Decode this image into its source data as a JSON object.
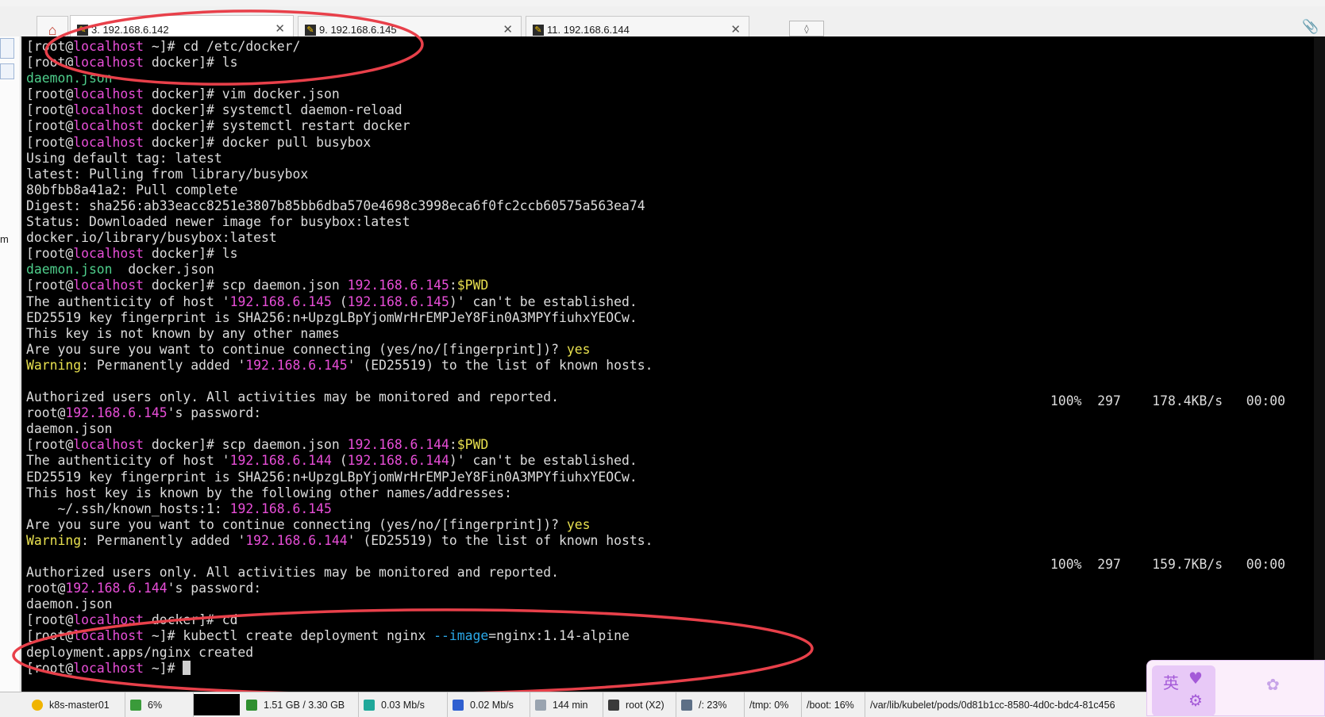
{
  "tabs": [
    {
      "label": "3. 192.168.6.142",
      "active": true
    },
    {
      "label": "9. 192.168.6.145",
      "active": false
    },
    {
      "label": "11. 192.168.6.144",
      "active": false
    }
  ],
  "terminal": {
    "lines": [
      [
        {
          "t": "[root@"
        },
        {
          "t": "localhost",
          "c": "m"
        },
        {
          "t": " ~]# cd /etc/docker/"
        }
      ],
      [
        {
          "t": "[root@"
        },
        {
          "t": "localhost",
          "c": "m"
        },
        {
          "t": " docker]# ls"
        }
      ],
      [
        {
          "t": "daemon.json",
          "c": "g"
        }
      ],
      [
        {
          "t": "[root@"
        },
        {
          "t": "localhost",
          "c": "m"
        },
        {
          "t": " docker]# vim docker.json"
        }
      ],
      [
        {
          "t": "[root@"
        },
        {
          "t": "localhost",
          "c": "m"
        },
        {
          "t": " docker]# systemctl daemon-reload"
        }
      ],
      [
        {
          "t": "[root@"
        },
        {
          "t": "localhost",
          "c": "m"
        },
        {
          "t": " docker]# systemctl restart docker"
        }
      ],
      [
        {
          "t": "[root@"
        },
        {
          "t": "localhost",
          "c": "m"
        },
        {
          "t": " docker]# docker pull busybox"
        }
      ],
      [
        {
          "t": "Using default tag: latest"
        }
      ],
      [
        {
          "t": "latest: Pulling from library/busybox"
        }
      ],
      [
        {
          "t": "80bfbb8a41a2: Pull complete"
        }
      ],
      [
        {
          "t": "Digest: sha256:ab33eacc8251e3807b85bb6dba570e4698c3998eca6f0fc2ccb60575a563ea74"
        }
      ],
      [
        {
          "t": "Status: Downloaded newer image for busybox:latest"
        }
      ],
      [
        {
          "t": "docker.io/library/busybox:latest"
        }
      ],
      [
        {
          "t": "[root@"
        },
        {
          "t": "localhost",
          "c": "m"
        },
        {
          "t": " docker]# ls"
        }
      ],
      [
        {
          "t": "daemon.json",
          "c": "g"
        },
        {
          "t": "  docker.json"
        }
      ],
      [
        {
          "t": "[root@"
        },
        {
          "t": "localhost",
          "c": "m"
        },
        {
          "t": " docker]# scp daemon.json "
        },
        {
          "t": "192.168.6.145",
          "c": "m"
        },
        {
          "t": ":"
        },
        {
          "t": "$PWD",
          "c": "y"
        }
      ],
      [
        {
          "t": "The authenticity of host '"
        },
        {
          "t": "192.168.6.145",
          "c": "m"
        },
        {
          "t": " ("
        },
        {
          "t": "192.168.6.145",
          "c": "m"
        },
        {
          "t": ")' can't be established."
        }
      ],
      [
        {
          "t": "ED25519 key fingerprint is SHA256:n+UpzgLBpYjomWrHrEMPJeY8Fin0A3MPYfiuhxYEOCw."
        }
      ],
      [
        {
          "t": "This key is not known by any other names"
        }
      ],
      [
        {
          "t": "Are you sure you want to continue connecting (yes/no/[fingerprint])? "
        },
        {
          "t": "yes",
          "c": "y"
        }
      ],
      [
        {
          "t": "Warning",
          "c": "y"
        },
        {
          "t": ": Permanently added '"
        },
        {
          "t": "192.168.6.145",
          "c": "m"
        },
        {
          "t": "' (ED25519) to the list of known hosts."
        }
      ],
      [
        {
          "t": ""
        }
      ],
      [
        {
          "t": "Authorized users only. All activities may be monitored and reported."
        }
      ],
      [
        {
          "t": "root@"
        },
        {
          "t": "192.168.6.145",
          "c": "m"
        },
        {
          "t": "'s password:"
        }
      ],
      [
        {
          "t": "daemon.json"
        }
      ],
      [
        {
          "t": "[root@"
        },
        {
          "t": "localhost",
          "c": "m"
        },
        {
          "t": " docker]# scp daemon.json "
        },
        {
          "t": "192.168.6.144",
          "c": "m"
        },
        {
          "t": ":"
        },
        {
          "t": "$PWD",
          "c": "y"
        }
      ],
      [
        {
          "t": "The authenticity of host '"
        },
        {
          "t": "192.168.6.144",
          "c": "m"
        },
        {
          "t": " ("
        },
        {
          "t": "192.168.6.144",
          "c": "m"
        },
        {
          "t": ")' can't be established."
        }
      ],
      [
        {
          "t": "ED25519 key fingerprint is SHA256:n+UpzgLBpYjomWrHrEMPJeY8Fin0A3MPYfiuhxYEOCw."
        }
      ],
      [
        {
          "t": "This host key is known by the following other names/addresses:"
        }
      ],
      [
        {
          "t": "    ~/.ssh/known_hosts:1: "
        },
        {
          "t": "192.168.6.145",
          "c": "m"
        }
      ],
      [
        {
          "t": "Are you sure you want to continue connecting (yes/no/[fingerprint])? "
        },
        {
          "t": "yes",
          "c": "y"
        }
      ],
      [
        {
          "t": "Warning",
          "c": "y"
        },
        {
          "t": ": Permanently added '"
        },
        {
          "t": "192.168.6.144",
          "c": "m"
        },
        {
          "t": "' (ED25519) to the list of known hosts."
        }
      ],
      [
        {
          "t": ""
        }
      ],
      [
        {
          "t": "Authorized users only. All activities may be monitored and reported."
        }
      ],
      [
        {
          "t": "root@"
        },
        {
          "t": "192.168.6.144",
          "c": "m"
        },
        {
          "t": "'s password:"
        }
      ],
      [
        {
          "t": "daemon.json"
        }
      ],
      [
        {
          "t": "[root@"
        },
        {
          "t": "localhost",
          "c": "m"
        },
        {
          "t": " docker]# cd"
        }
      ],
      [
        {
          "t": "[root@"
        },
        {
          "t": "localhost",
          "c": "m"
        },
        {
          "t": " ~]# kubectl create deployment nginx "
        },
        {
          "t": "--image",
          "c": "c"
        },
        {
          "t": "=nginx:1.14-alpine"
        }
      ],
      [
        {
          "t": "deployment.apps/nginx created"
        }
      ],
      [
        {
          "t": "[root@"
        },
        {
          "t": "localhost",
          "c": "m"
        },
        {
          "t": " ~]# "
        }
      ]
    ],
    "transfer_1": "100%  297    178.4KB/s   00:00",
    "transfer_2": "100%  297    159.7KB/s   00:00"
  },
  "left_panel": {
    "label": "m"
  },
  "statusbar": {
    "host": "k8s-master01",
    "cpu": "6%",
    "memory": "1.51 GB / 3.30 GB",
    "upload": "0.03 Mb/s",
    "download": "0.02 Mb/s",
    "uptime": "144 min",
    "user": "root (X2)",
    "disk_root": "/: 23%",
    "disk_tmp": "/tmp: 0%",
    "disk_boot": "/boot: 16%",
    "disk_path": "/var/lib/kubelet/pods/0d81b1cc-8580-4d0c-bdc4-81c456"
  },
  "sticker": {
    "text": "英"
  },
  "colors": {
    "terminal_bg": "#000000",
    "terminal_fg": "#dcdcdc",
    "magenta": "#e84ed8",
    "green": "#4fcf8c",
    "yellow": "#e8e04f",
    "cyan": "#2aa8e8",
    "annotation": "#e8404a"
  }
}
